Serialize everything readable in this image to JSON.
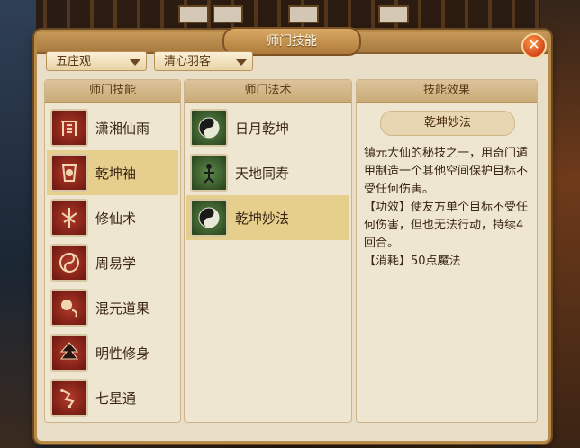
{
  "window": {
    "title": "师门技能"
  },
  "filters": {
    "dropdown1": "五庄观",
    "dropdown2": "清心羽客"
  },
  "skills_column": {
    "header": "师门技能",
    "items": [
      {
        "label": "潇湘仙雨",
        "icon": "pavilion-icon"
      },
      {
        "label": "乾坤袖",
        "icon": "sleeve-icon"
      },
      {
        "label": "修仙术",
        "icon": "crane-icon"
      },
      {
        "label": "周易学",
        "icon": "taiji-icon"
      },
      {
        "label": "混元道果",
        "icon": "orb-icon"
      },
      {
        "label": "明性修身",
        "icon": "tree-icon"
      },
      {
        "label": "七星通",
        "icon": "constellation-icon"
      }
    ],
    "selected_index": 1
  },
  "spells_column": {
    "header": "师门法术",
    "items": [
      {
        "label": "日月乾坤",
        "icon": "yinyang-icon"
      },
      {
        "label": "天地同寿",
        "icon": "figure-icon"
      },
      {
        "label": "乾坤妙法",
        "icon": "yinyang-icon"
      }
    ],
    "selected_index": 2
  },
  "effect_column": {
    "header": "技能效果",
    "skill_name": "乾坤妙法",
    "description": "镇元大仙的秘技之一，用奇门遁甲制造一个其他空间保护目标不受任何伤害。",
    "effect": "【功效】使友方单个目标不受任何伤害，但也无法行动，持续4回合。",
    "cost": "【消耗】50点魔法"
  },
  "colors": {
    "selected": "#e6cf8c",
    "panel": "#e9dfc8",
    "accent": "#b88b4a"
  }
}
